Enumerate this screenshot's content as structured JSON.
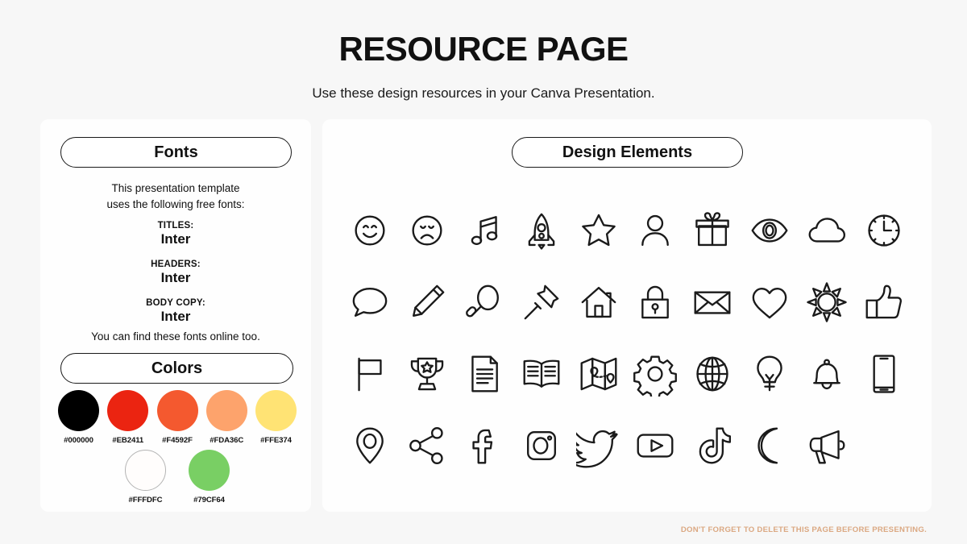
{
  "header": {
    "title": "RESOURCE PAGE",
    "subtitle": "Use these design resources in your Canva Presentation."
  },
  "fonts_panel": {
    "heading": "Fonts",
    "intro": "This presentation template\nuses the following free fonts:",
    "groups": [
      {
        "label": "TITLES:",
        "value": "Inter"
      },
      {
        "label": "HEADERS:",
        "value": "Inter"
      },
      {
        "label": "BODY COPY:",
        "value": "Inter"
      }
    ],
    "outro": "You can find these fonts online too."
  },
  "colors_panel": {
    "heading": "Colors",
    "row1": [
      {
        "hex": "#000000",
        "label": "#000000"
      },
      {
        "hex": "#EB2411",
        "label": "#EB2411"
      },
      {
        "hex": "#F4592F",
        "label": "#F4592F"
      },
      {
        "hex": "#FDA36C",
        "label": "#FDA36C"
      },
      {
        "hex": "#FFE374",
        "label": "#FFE374"
      }
    ],
    "row2": [
      {
        "hex": "#FFFDFC",
        "label": "#FFFDFC"
      },
      {
        "hex": "#79CF64",
        "label": "#79CF64"
      }
    ]
  },
  "elements_panel": {
    "heading": "Design Elements",
    "icons": [
      "smiley-face-icon",
      "sad-face-icon",
      "music-note-icon",
      "rocket-icon",
      "star-icon",
      "person-icon",
      "gift-icon",
      "eye-icon",
      "cloud-icon",
      "clock-icon",
      "speech-bubble-icon",
      "pencil-icon",
      "magnifier-icon",
      "pushpin-icon",
      "house-icon",
      "lock-icon",
      "envelope-icon",
      "heart-icon",
      "sun-icon",
      "thumbs-up-icon",
      "flag-icon",
      "trophy-icon",
      "document-icon",
      "book-icon",
      "map-icon",
      "gear-icon",
      "globe-icon",
      "lightbulb-icon",
      "bell-icon",
      "phone-icon",
      "location-pin-icon",
      "share-icon",
      "facebook-icon",
      "instagram-icon",
      "twitter-icon",
      "youtube-icon",
      "tiktok-icon",
      "moon-icon",
      "megaphone-icon"
    ]
  },
  "footer": {
    "note": "DON'T FORGET TO DELETE THIS PAGE BEFORE PRESENTING.",
    "note_color": "#DBA882"
  }
}
